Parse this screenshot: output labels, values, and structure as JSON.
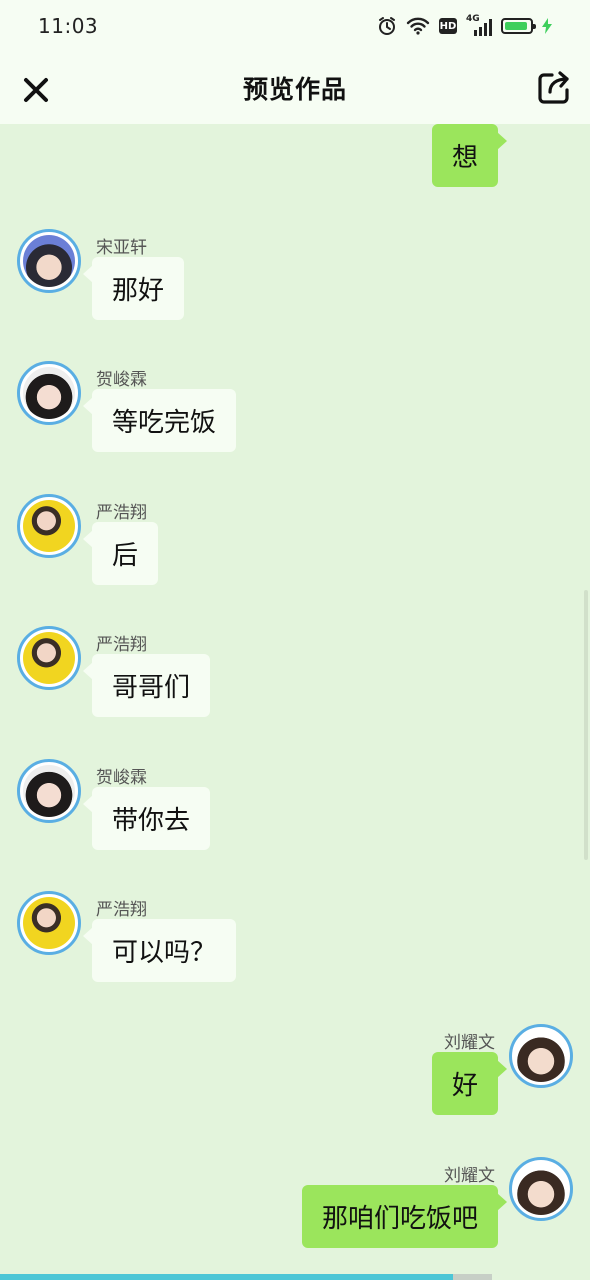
{
  "status_bar": {
    "time": "11:03",
    "icons": [
      "alarm-icon",
      "wifi-icon",
      "hd-icon",
      "signal-4g-icon",
      "battery-icon",
      "charging-icon"
    ],
    "hd_label": "HD",
    "network_label": "4G",
    "battery_level": 0.9
  },
  "header": {
    "title": "预览作品",
    "close_icon": "close-icon",
    "share_icon": "share-icon"
  },
  "colors": {
    "background": "#e3f4dc",
    "bar_background": "#f6fdf3",
    "incoming_bubble": "#f6fdf3",
    "outgoing_bubble": "#9be55c",
    "avatar_ring": "#5aaee3",
    "progress": "#4cc6d6"
  },
  "messages": [
    {
      "side": "right",
      "sender": "",
      "text": "想",
      "avatar": "avatar-liu-yaowen"
    },
    {
      "side": "left",
      "sender": "宋亚轩",
      "text": "那好",
      "avatar": "avatar-song-yaxuan"
    },
    {
      "side": "left",
      "sender": "贺峻霖",
      "text": "等吃完饭",
      "avatar": "avatar-he-junlin"
    },
    {
      "side": "left",
      "sender": "严浩翔",
      "text": "后",
      "avatar": "avatar-yan-haoxiang"
    },
    {
      "side": "left",
      "sender": "严浩翔",
      "text": "哥哥们",
      "avatar": "avatar-yan-haoxiang"
    },
    {
      "side": "left",
      "sender": "贺峻霖",
      "text": "带你去",
      "avatar": "avatar-he-junlin"
    },
    {
      "side": "left",
      "sender": "严浩翔",
      "text": "可以吗？",
      "avatar": "avatar-yan-haoxiang"
    },
    {
      "side": "right",
      "sender": "刘耀文",
      "text": "好",
      "avatar": "avatar-liu-yaowen"
    },
    {
      "side": "right",
      "sender": "刘耀文",
      "text": "那咱们吃饭吧",
      "avatar": "avatar-liu-yaowen"
    }
  ],
  "playback": {
    "progress": 0.92
  }
}
